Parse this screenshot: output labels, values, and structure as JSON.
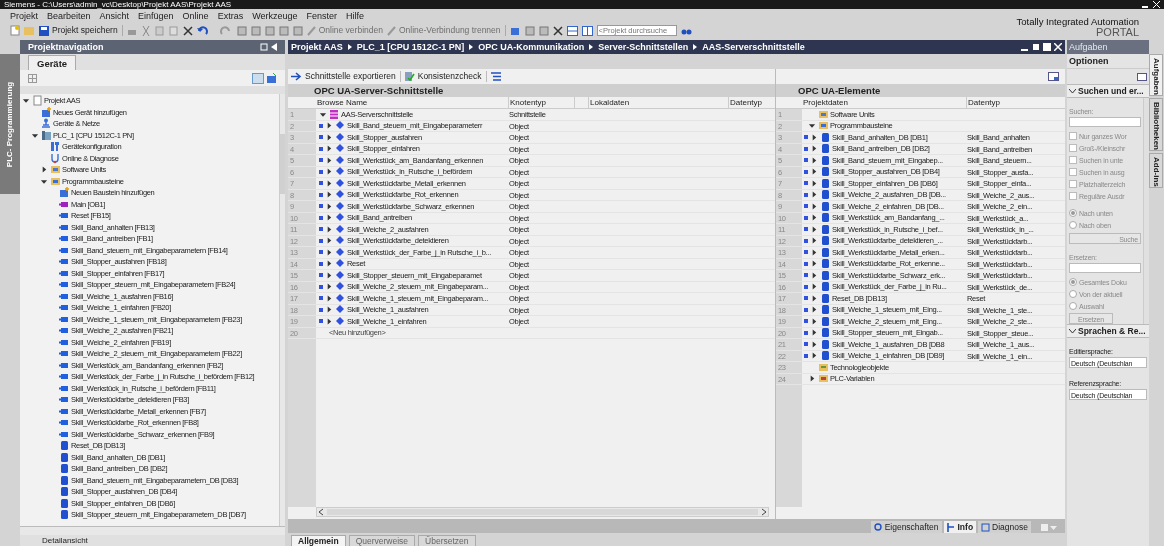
{
  "window": {
    "title": "Siemens - C:\\Users\\admin_vc\\Desktop\\Projekt AAS\\Projekt AAS"
  },
  "menu": [
    "Projekt",
    "Bearbeiten",
    "Ansicht",
    "Einfügen",
    "Online",
    "Extras",
    "Werkzeuge",
    "Fenster",
    "Hilfe"
  ],
  "toolbar": {
    "save_label": "Projekt speichern",
    "online_connect": {
      "label": "Online verbinden",
      "disabled": true
    },
    "online_disconnect": {
      "label": "Online-Verbindung trennen",
      "disabled": true
    },
    "search": {
      "placeholder": "<Projekt durchsuche"
    }
  },
  "brand": {
    "line1": "Totally Integrated Automation",
    "line2": "PORTAL"
  },
  "left_strip": {
    "label": "PLC- Programmierung"
  },
  "project_navigation": {
    "title": "Projektnavigation",
    "tabs": [
      {
        "label": "Geräte",
        "selected": true
      }
    ],
    "tree": [
      {
        "label": "Projekt AAS",
        "kind": "project",
        "expanded": true,
        "children": [
          {
            "label": "Neues Gerät hinzufügen",
            "kind": "add"
          },
          {
            "label": "Geräte & Netze",
            "kind": "network"
          },
          {
            "label": "PLC_1 [CPU 1512C-1 PN]",
            "kind": "plc",
            "expanded": true,
            "children": [
              {
                "label": "Gerätekonfiguration",
                "kind": "config"
              },
              {
                "label": "Online & Diagnose",
                "kind": "online"
              },
              {
                "label": "Software Units",
                "kind": "units",
                "expanded": false
              },
              {
                "label": "Programmbausteine",
                "kind": "blocks",
                "expanded": true,
                "children": [
                  {
                    "label": "Neuen Baustein hinzufügen",
                    "kind": "add"
                  },
                  {
                    "label": "Main [OB1]",
                    "kind": "ob"
                  },
                  {
                    "label": "Reset [FB15]",
                    "kind": "fb"
                  },
                  {
                    "label": "Skill_Band_anhalten [FB13]",
                    "kind": "fb"
                  },
                  {
                    "label": "Skill_Band_antreiben [FB1]",
                    "kind": "fb"
                  },
                  {
                    "label": "Skill_Band_steuern_mit_Eingabeparametern [FB14]",
                    "kind": "fb"
                  },
                  {
                    "label": "Skill_Stopper_ausfahren [FB18]",
                    "kind": "fb"
                  },
                  {
                    "label": "Skill_Stopper_einfahren [FB17]",
                    "kind": "fb"
                  },
                  {
                    "label": "Skill_Stopper_steuern_mit_Eingabeparametern [FB24]",
                    "kind": "fb"
                  },
                  {
                    "label": "Skill_Weiche_1_ausfahren [FB16]",
                    "kind": "fb"
                  },
                  {
                    "label": "Skill_Weiche_1_einfahren [FB20]",
                    "kind": "fb"
                  },
                  {
                    "label": "Skill_Weiche_1_steuern_mit_Eingabeparametern [FB23]",
                    "kind": "fb"
                  },
                  {
                    "label": "Skill_Weiche_2_ausfahren [FB21]",
                    "kind": "fb"
                  },
                  {
                    "label": "Skill_Weiche_2_einfahren [FB19]",
                    "kind": "fb"
                  },
                  {
                    "label": "Skill_Weiche_2_steuern_mit_Eingabeparametern [FB22]",
                    "kind": "fb"
                  },
                  {
                    "label": "Skill_Werkstück_am_Bandanfang_erkennen [FB2]",
                    "kind": "fb"
                  },
                  {
                    "label": "Skill_Werkstück_der_Farbe_j_in Rutsche_i_befördern [FB12]",
                    "kind": "fb"
                  },
                  {
                    "label": "Skill_Werkstück_in_Rutsche_i_befördern [FB11]",
                    "kind": "fb"
                  },
                  {
                    "label": "Skill_Werkstückfarbe_detektieren [FB3]",
                    "kind": "fb"
                  },
                  {
                    "label": "Skill_Werkstückfarbe_Metall_erkennen [FB7]",
                    "kind": "fb"
                  },
                  {
                    "label": "Skill_Werkstückfarbe_Rot_erkennen [FB8]",
                    "kind": "fb"
                  },
                  {
                    "label": "Skill_Werkstückfarbe_Schwarz_erkennen [FB9]",
                    "kind": "fb"
                  },
                  {
                    "label": "Reset_DB [DB13]",
                    "kind": "db"
                  },
                  {
                    "label": "Skill_Band_anhalten_DB [DB1]",
                    "kind": "db"
                  },
                  {
                    "label": "Skill_Band_antreiben_DB [DB2]",
                    "kind": "db"
                  },
                  {
                    "label": "Skill_Band_steuern_mit_Eingabeparametern_DB [DB3]",
                    "kind": "db"
                  },
                  {
                    "label": "Skill_Stopper_ausfahren_DB [DB4]",
                    "kind": "db"
                  },
                  {
                    "label": "Skill_Stopper_einfahren_DB [DB6]",
                    "kind": "db"
                  },
                  {
                    "label": "Skill_Stopper_steuern_mit_Eingabeparametern_DB [DB7]",
                    "kind": "db"
                  }
                ]
              }
            ]
          }
        ]
      }
    ],
    "details_label": "Detailansicht"
  },
  "breadcrumb": [
    "Projekt AAS",
    "PLC_1 [CPU 1512C-1 PN]",
    "OPC UA-Kommunikation",
    "Server-Schnittstellen",
    "AAS-Serverschnittstelle"
  ],
  "editor_toolbar": [
    "Schnittstelle exportieren",
    "Konsistenzcheck"
  ],
  "server_interface": {
    "title": "OPC UA-Server-Schnittstelle",
    "columns": [
      "Browse Name",
      "Knotentyp",
      "Lokaldaten",
      "Datentyp"
    ],
    "rows": [
      {
        "number": "1",
        "name": "AAS-Serverschnittstelle",
        "node_type": "Schnittstelle",
        "kind": "interface",
        "expanded": true
      },
      {
        "number": "2",
        "name": "Skill_Band_steuern_mit_Eingabeparameterr",
        "node_type": "Object",
        "kind": "object",
        "expanded": false
      },
      {
        "number": "3",
        "name": "Skill_Stopper_ausfahren",
        "node_type": "Object",
        "kind": "object",
        "expanded": false
      },
      {
        "number": "4",
        "name": "Skill_Stopper_einfahren",
        "node_type": "Object",
        "kind": "object",
        "expanded": false
      },
      {
        "number": "5",
        "name": "Skill_Werkstück_am_Bandanfang_erkennen",
        "node_type": "Object",
        "kind": "object",
        "expanded": false
      },
      {
        "number": "6",
        "name": "Skill_Werkstück_in_Rutsche_i_befördern",
        "node_type": "Object",
        "kind": "object",
        "expanded": false
      },
      {
        "number": "7",
        "name": "Skill_Werkstückfarbe_Metall_erkennen",
        "node_type": "Object",
        "kind": "object",
        "expanded": false
      },
      {
        "number": "8",
        "name": "Skill_Werkstückfarbe_Rot_erkennen",
        "node_type": "Object",
        "kind": "object",
        "expanded": false
      },
      {
        "number": "9",
        "name": "Skill_Werkstückfarbe_Schwarz_erkennen",
        "node_type": "Object",
        "kind": "object",
        "expanded": false
      },
      {
        "number": "10",
        "name": "Skill_Band_antreiben",
        "node_type": "Object",
        "kind": "object",
        "expanded": false
      },
      {
        "number": "11",
        "name": "Skill_Weiche_2_ausfahren",
        "node_type": "Object",
        "kind": "object",
        "expanded": false
      },
      {
        "number": "12",
        "name": "Skill_Werkstückfarbe_detektieren",
        "node_type": "Object",
        "kind": "object",
        "expanded": false
      },
      {
        "number": "13",
        "name": "Skill_Werkstück_der_Farbe_j_in Rutsche_i_b...",
        "node_type": "Object",
        "kind": "object",
        "expanded": false
      },
      {
        "number": "14",
        "name": "Reset",
        "node_type": "Object",
        "kind": "object",
        "expanded": false
      },
      {
        "number": "15",
        "name": "Skill_Stopper_steuern_mit_Eingabeparamet",
        "node_type": "Object",
        "kind": "object",
        "expanded": false
      },
      {
        "number": "16",
        "name": "Skill_Weiche_2_steuern_mit_Eingabeparam...",
        "node_type": "Object",
        "kind": "object",
        "expanded": false
      },
      {
        "number": "17",
        "name": "Skill_Weiche_1_steuern_mit_Eingabeparam...",
        "node_type": "Object",
        "kind": "object",
        "expanded": false
      },
      {
        "number": "18",
        "name": "Skill_Weiche_1_ausfahren",
        "node_type": "Object",
        "kind": "object",
        "expanded": false
      },
      {
        "number": "19",
        "name": "Skill_Weiche_1_einfahren",
        "node_type": "Object",
        "kind": "object",
        "expanded": false
      },
      {
        "number": "20",
        "name": "<Neu hinzufügen>",
        "kind": "add"
      }
    ]
  },
  "opc_elements": {
    "title": "OPC UA-Elemente",
    "columns": [
      "Projektdaten",
      "Datentyp"
    ],
    "rows": [
      {
        "number": "1",
        "name": "Software Units",
        "kind": "units"
      },
      {
        "number": "2",
        "name": "Programmbausteine",
        "kind": "blocks",
        "expanded": true
      },
      {
        "number": "3",
        "name": "Skill_Band_anhalten_DB [DB1]",
        "datatype": "Skill_Band_anhalten",
        "kind": "db",
        "expanded": false
      },
      {
        "number": "4",
        "name": "Skill_Band_antreiben_DB [DB2]",
        "datatype": "Skill_Band_antreiben",
        "kind": "db",
        "expanded": false
      },
      {
        "number": "5",
        "name": "Skill_Band_steuern_mit_Eingabep...",
        "datatype": "Skill_Band_steuern...",
        "kind": "db",
        "expanded": false
      },
      {
        "number": "6",
        "name": "Skill_Stopper_ausfahren_DB [DB4]",
        "datatype": "Skill_Stopper_ausfa...",
        "kind": "db",
        "expanded": false
      },
      {
        "number": "7",
        "name": "Skill_Stopper_einfahren_DB [DB6]",
        "datatype": "Skill_Stopper_einfa...",
        "kind": "db",
        "expanded": false
      },
      {
        "number": "8",
        "name": "Skill_Weiche_2_ausfahren_DB [DB...",
        "datatype": "Skill_Weiche_2_aus...",
        "kind": "db",
        "expanded": false
      },
      {
        "number": "9",
        "name": "Skill_Weiche_2_einfahren_DB [DB...",
        "datatype": "Skill_Weiche_2_ein...",
        "kind": "db",
        "expanded": false
      },
      {
        "number": "10",
        "name": "Skill_Werkstück_am_Bandanfang_...",
        "datatype": "Skill_Werkstück_a...",
        "kind": "db",
        "expanded": false
      },
      {
        "number": "11",
        "name": "Skill_Werkstück_in_Rutsche_i_bef...",
        "datatype": "Skill_Werkstück_in_...",
        "kind": "db",
        "expanded": false
      },
      {
        "number": "12",
        "name": "Skill_Werkstückfarbe_detektieren_...",
        "datatype": "Skill_Werkstückfarb...",
        "kind": "db",
        "expanded": false
      },
      {
        "number": "13",
        "name": "Skill_Werkstückfarbe_Metall_erken...",
        "datatype": "Skill_Werkstückfarb...",
        "kind": "db",
        "expanded": false
      },
      {
        "number": "14",
        "name": "Skill_Werkstückfarbe_Rot_erkenne...",
        "datatype": "Skill_Werkstückfarb...",
        "kind": "db",
        "expanded": false
      },
      {
        "number": "15",
        "name": "Skill_Werkstückfarbe_Schwarz_erk...",
        "datatype": "Skill_Werkstückfarb...",
        "kind": "db",
        "expanded": false
      },
      {
        "number": "16",
        "name": "Skill_Werkstück_der_Farbe_j_in Ru...",
        "datatype": "Skill_Werkstück_de...",
        "kind": "db",
        "expanded": false
      },
      {
        "number": "17",
        "name": "Reset_DB [DB13]",
        "datatype": "Reset",
        "kind": "db",
        "expanded": false
      },
      {
        "number": "18",
        "name": "Skill_Weiche_1_steuern_mit_Eing...",
        "datatype": "Skill_Weiche_1_ste...",
        "kind": "db",
        "expanded": false
      },
      {
        "number": "19",
        "name": "Skill_Weiche_2_steuern_mit_Eing...",
        "datatype": "Skill_Weiche_2_ste...",
        "kind": "db",
        "expanded": false
      },
      {
        "number": "20",
        "name": "Skill_Stopper_steuern_mit_Eingab...",
        "datatype": "Skill_Stopper_steue...",
        "kind": "db",
        "expanded": false
      },
      {
        "number": "21",
        "name": "Skill_Weiche_1_ausfahren_DB [DB8",
        "datatype": "Skill_Weiche_1_aus...",
        "kind": "db",
        "expanded": false
      },
      {
        "number": "22",
        "name": "Skill_Weiche_1_einfahren_DB [DB9]",
        "datatype": "Skill_Weiche_1_ein...",
        "kind": "db",
        "expanded": false
      },
      {
        "number": "23",
        "name": "Technologieobjekte",
        "kind": "tech"
      },
      {
        "number": "24",
        "name": "PLC-Variablen",
        "kind": "tags",
        "expanded": false
      }
    ]
  },
  "inspector_tabs": [
    {
      "label": "Eigenschaften",
      "selected": false
    },
    {
      "label": "Info",
      "selected": true
    },
    {
      "label": "Diagnose",
      "selected": false
    }
  ],
  "bottom_tabs": [
    {
      "label": "Allgemein",
      "selected": true
    },
    {
      "label": "Querverweise",
      "selected": false
    },
    {
      "label": "Übersetzen",
      "selected": false
    }
  ],
  "task_panel": {
    "title": "Aufgaben",
    "options_label": "Optionen",
    "search_section": {
      "title": "Suchen und er...",
      "expanded": true,
      "search_label": "Suchen:",
      "checkboxes": [
        {
          "label": "Nur ganzes Wor",
          "checked": false
        },
        {
          "label": "Groß-/Kleinschr",
          "checked": false
        },
        {
          "label": "Suchen in unte",
          "checked": false
        },
        {
          "label": "Suchen in ausg",
          "checked": false
        },
        {
          "label": "Platzhalterzeich",
          "checked": false
        },
        {
          "label": "Reguläre Ausdr",
          "checked": false
        }
      ],
      "direction": [
        {
          "label": "Nach unten",
          "selected": true
        },
        {
          "label": "Nach oben",
          "selected": false
        }
      ],
      "search_button": "Suche",
      "replace_label": "Ersetzen:",
      "scope": [
        {
          "label": "Gesamtes Doku",
          "selected": true
        },
        {
          "label": "Von der aktuell",
          "selected": false
        },
        {
          "label": "Auswahl",
          "selected": false
        }
      ],
      "replace_button": "Ersetzen"
    },
    "language_section": {
      "title": "Sprachen & Re...",
      "expanded": true,
      "edit_label": "Editiersprache:",
      "edit_value": "Deutsch (Deutschlan",
      "ref_label": "Referenzsprache:",
      "ref_value": "Deutsch (Deutschlan"
    }
  },
  "side_tabs": [
    {
      "label": "Aufgaben",
      "selected": true
    },
    {
      "label": "Bibliotheken",
      "selected": false
    },
    {
      "label": "Add-ins",
      "selected": false
    }
  ]
}
